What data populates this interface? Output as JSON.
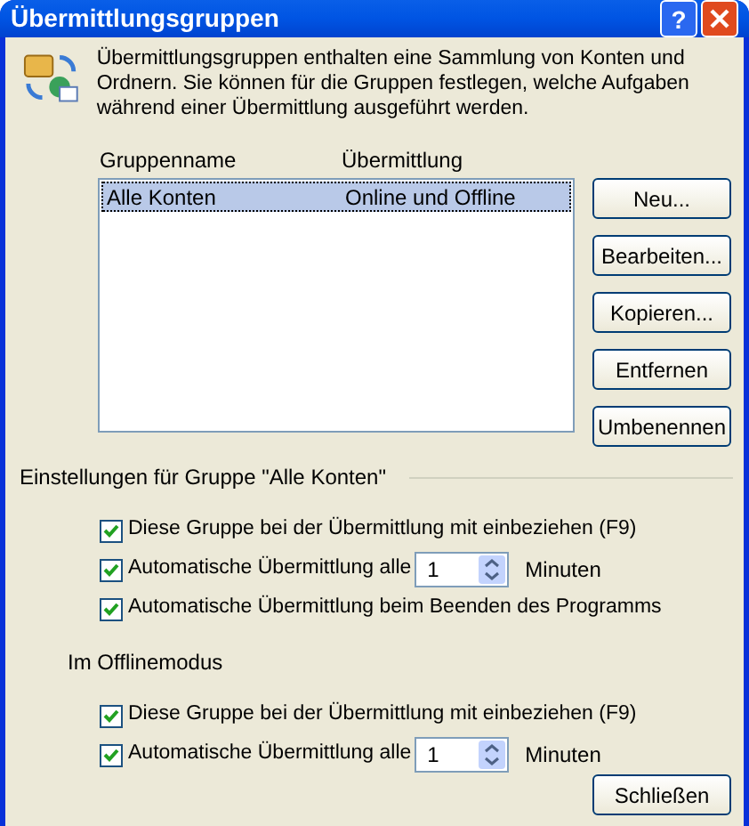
{
  "window": {
    "title": "Übermittlungsgruppen",
    "buttons": [
      "?"
    ]
  },
  "description": "Übermittlungsgruppen enthalten eine Sammlung von Konten und Ordnern. Sie können für die Gruppen festlegen, welche Aufgaben während einer Übermittlung ausgeführt werden.",
  "table": {
    "columns": [
      "Gruppenname",
      "Übermittlung"
    ],
    "rows": [
      {
        "cells": [
          "Alle Konten",
          "Online und Offline"
        ],
        "selected": true
      }
    ]
  },
  "side_buttons": [
    "Neu...",
    "Bearbeiten...",
    "Kopieren...",
    "Entfernen",
    "Umbenennen"
  ],
  "sections": [
    {
      "title": "Einstellungen für Gruppe \"Alle Konten\"",
      "kind": "group",
      "options": [
        {
          "kind": "checkbox",
          "label": "Diese Gruppe bei der Übermittlung mit einbeziehen (F9)",
          "checked": true
        },
        {
          "kind": "interval",
          "label": "Automatische Übermittlung alle",
          "checked": true,
          "value": "1",
          "unit": "Minuten"
        },
        {
          "kind": "checkbox",
          "label": "Automatische Übermittlung beim Beenden des Programms",
          "checked": true
        }
      ]
    },
    {
      "title": "Im Offlinemodus",
      "kind": "subgroup",
      "options": [
        {
          "kind": "checkbox",
          "label": "Diese Gruppe bei der Übermittlung mit einbeziehen (F9)",
          "checked": true
        },
        {
          "kind": "interval",
          "label": "Automatische Übermittlung alle",
          "checked": true,
          "value": "1",
          "unit": "Minuten"
        }
      ]
    }
  ],
  "close_button": "Schließen"
}
